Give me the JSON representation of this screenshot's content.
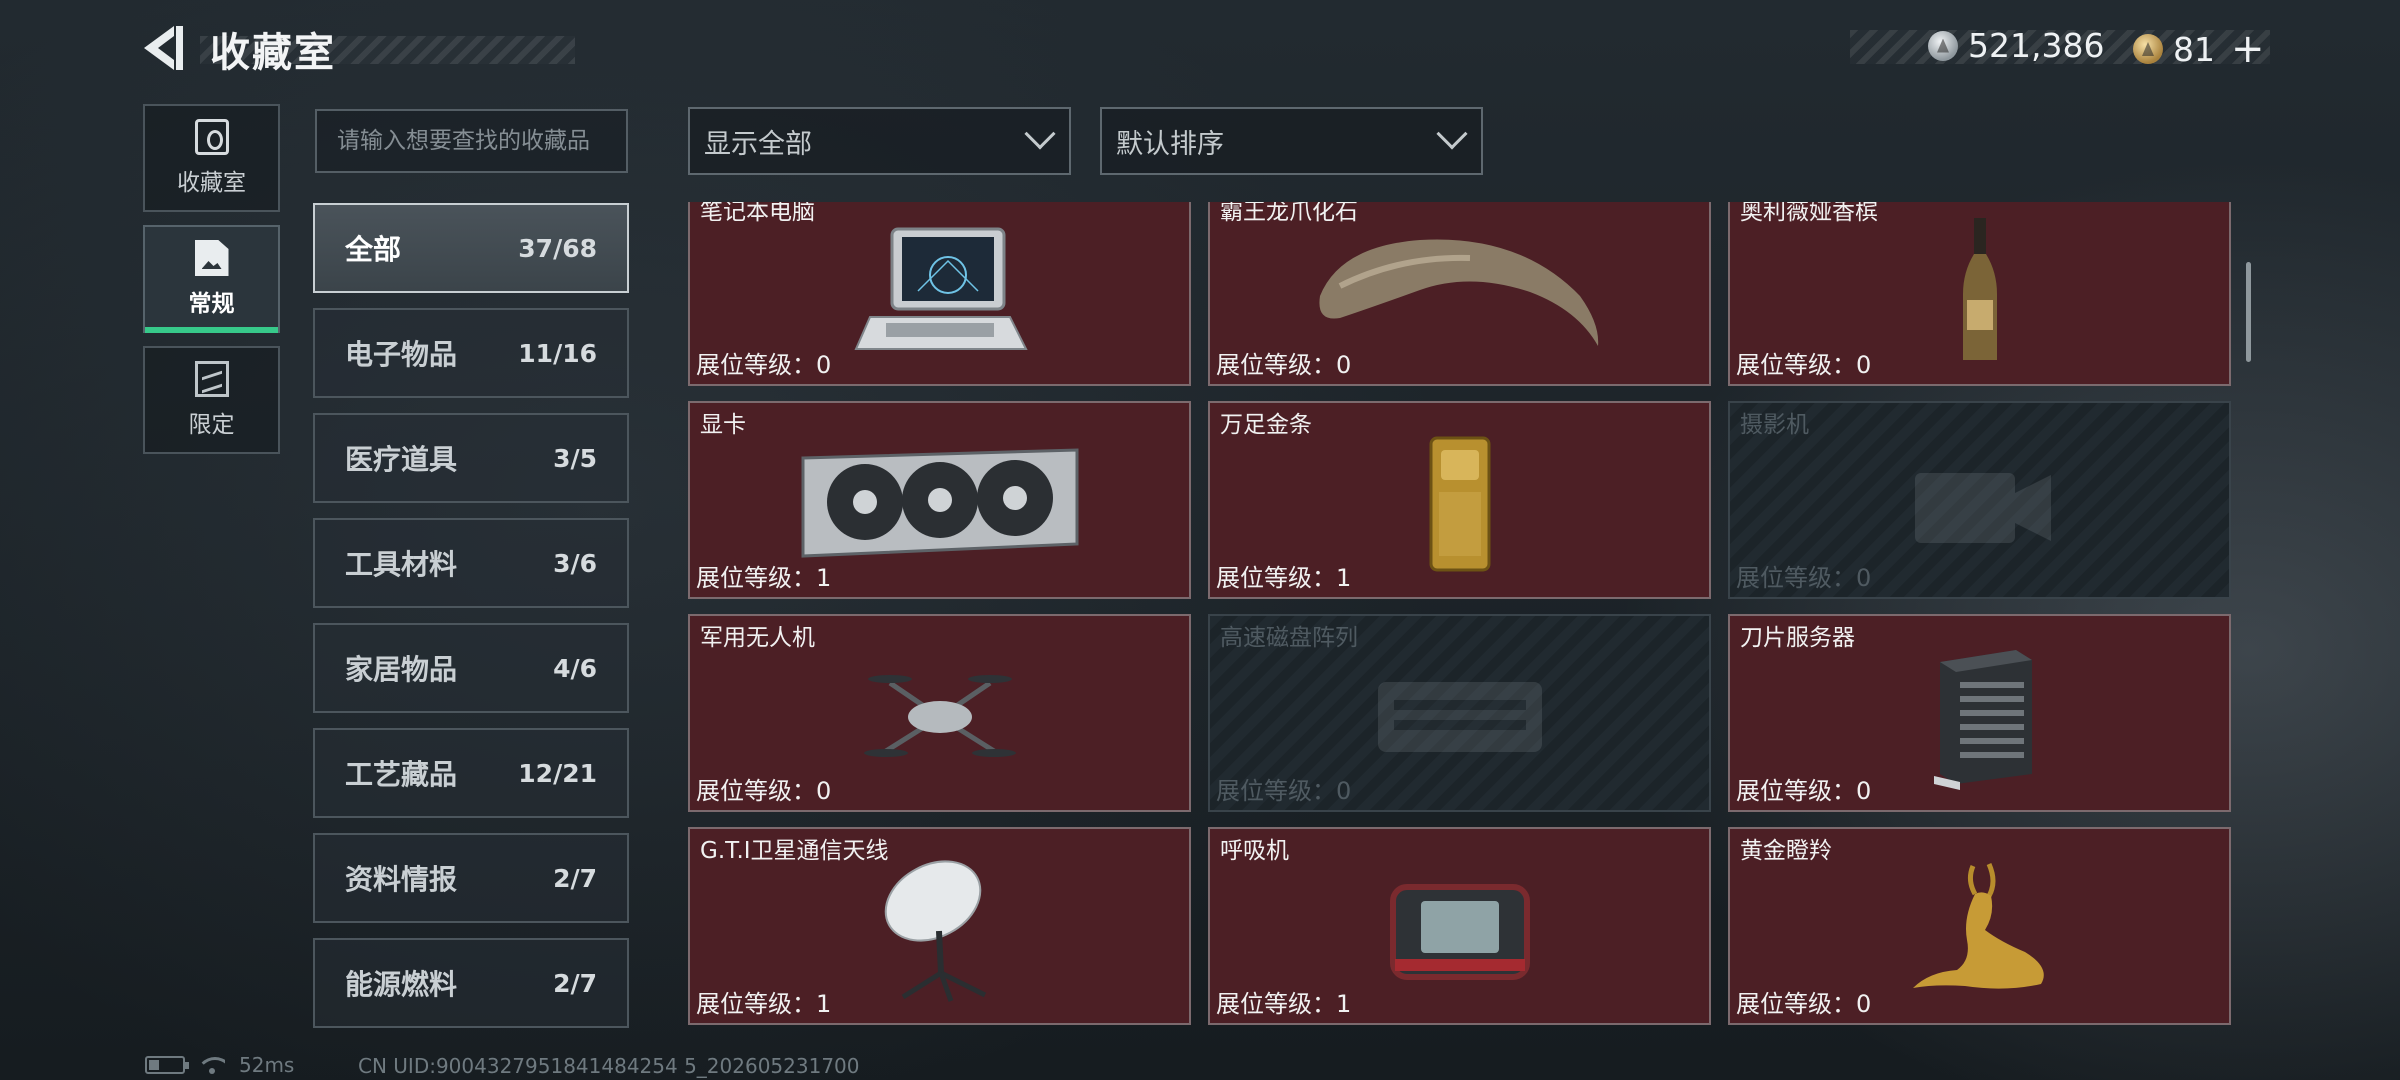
{
  "header": {
    "title": "收藏室",
    "currency": {
      "silver": "521,386",
      "gold": "81"
    },
    "plus_label": "+"
  },
  "side_tabs": [
    {
      "label": "收藏室",
      "icon": "vault-icon",
      "active": false
    },
    {
      "label": "常规",
      "icon": "document-icon",
      "active": true
    },
    {
      "label": "限定",
      "icon": "picture-icon",
      "active": false
    }
  ],
  "search": {
    "placeholder": "请输入想要查找的收藏品",
    "value": ""
  },
  "filters": {
    "display": "显示全部",
    "sort": "默认排序"
  },
  "categories": [
    {
      "name": "全部",
      "count": "37/68",
      "active": true
    },
    {
      "name": "电子物品",
      "count": "11/16"
    },
    {
      "name": "医疗道具",
      "count": "3/5"
    },
    {
      "name": "工具材料",
      "count": "3/6"
    },
    {
      "name": "家居物品",
      "count": "4/6"
    },
    {
      "name": "工艺藏品",
      "count": "12/21"
    },
    {
      "name": "资料情报",
      "count": "2/7"
    },
    {
      "name": "能源燃料",
      "count": "2/7"
    }
  ],
  "items": [
    {
      "name": "笔记本电脑",
      "level": "展位等级：0",
      "icon": "laptop-icon",
      "locked": false
    },
    {
      "name": "霸王龙爪化石",
      "level": "展位等级：0",
      "icon": "claw-fossil-icon",
      "locked": false
    },
    {
      "name": "奥利薇娅香槟",
      "level": "展位等级：0",
      "icon": "champagne-icon",
      "locked": false
    },
    {
      "name": "显卡",
      "level": "展位等级：1",
      "icon": "graphics-card-icon",
      "locked": false
    },
    {
      "name": "万足金条",
      "level": "展位等级：1",
      "icon": "gold-bar-icon",
      "locked": false
    },
    {
      "name": "摄影机",
      "level": "展位等级：0",
      "icon": "camera-icon",
      "locked": true
    },
    {
      "name": "军用无人机",
      "level": "展位等级：0",
      "icon": "drone-icon",
      "locked": false
    },
    {
      "name": "高速磁盘阵列",
      "level": "展位等级：0",
      "icon": "disk-array-icon",
      "locked": true
    },
    {
      "name": "刀片服务器",
      "level": "展位等级：0",
      "icon": "server-icon",
      "locked": false
    },
    {
      "name": "G.T.I卫星通信天线",
      "level": "展位等级：1",
      "icon": "satellite-dish-icon",
      "locked": false
    },
    {
      "name": "呼吸机",
      "level": "展位等级：1",
      "icon": "ventilator-icon",
      "locked": false
    },
    {
      "name": "黄金瞪羚",
      "level": "展位等级：0",
      "icon": "golden-gazelle-icon",
      "locked": false
    }
  ],
  "status": {
    "ping": "52ms",
    "uid": "CN UID:9004327951841484254 5_202605231700"
  },
  "colors": {
    "card_bg": "#4c1f25",
    "accent": "#37c98a",
    "locked_bg": "#212a30"
  }
}
